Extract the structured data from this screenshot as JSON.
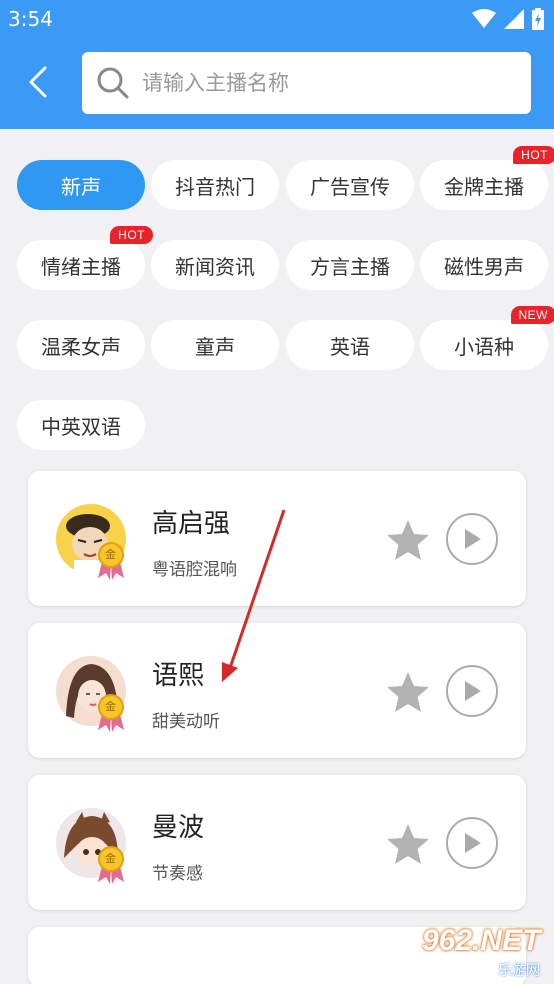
{
  "status_bar": {
    "time": "3:54"
  },
  "search": {
    "placeholder": "请输入主播名称"
  },
  "tags": [
    {
      "label": "新声",
      "active": true,
      "badge": ""
    },
    {
      "label": "抖音热门",
      "active": false,
      "badge": ""
    },
    {
      "label": "广告宣传",
      "active": false,
      "badge": ""
    },
    {
      "label": "金牌主播",
      "active": false,
      "badge": "HOT"
    },
    {
      "label": "情绪主播",
      "active": false,
      "badge": "HOT"
    },
    {
      "label": "新闻资讯",
      "active": false,
      "badge": ""
    },
    {
      "label": "方言主播",
      "active": false,
      "badge": ""
    },
    {
      "label": "磁性男声",
      "active": false,
      "badge": ""
    },
    {
      "label": "温柔女声",
      "active": false,
      "badge": ""
    },
    {
      "label": "童声",
      "active": false,
      "badge": ""
    },
    {
      "label": "英语",
      "active": false,
      "badge": ""
    },
    {
      "label": "小语种",
      "active": false,
      "badge": "NEW"
    },
    {
      "label": "中英双语",
      "active": false,
      "badge": ""
    }
  ],
  "anchors": [
    {
      "name": "高启强",
      "desc": "粤语腔混响",
      "medal": "金"
    },
    {
      "name": "语熙",
      "desc": "甜美动听",
      "medal": "金"
    },
    {
      "name": "曼波",
      "desc": "节奏感",
      "medal": "金"
    }
  ],
  "watermark": {
    "text": "962.NET",
    "sub": "乐游网"
  },
  "colors": {
    "primary": "#3a9af5",
    "active_tag": "#2e98f3",
    "badge": "#e8232b",
    "background": "#f1f1f3"
  },
  "icons": {
    "back": "chevron-left-icon",
    "search": "search-icon",
    "favorite": "star-icon",
    "play": "play-icon"
  }
}
